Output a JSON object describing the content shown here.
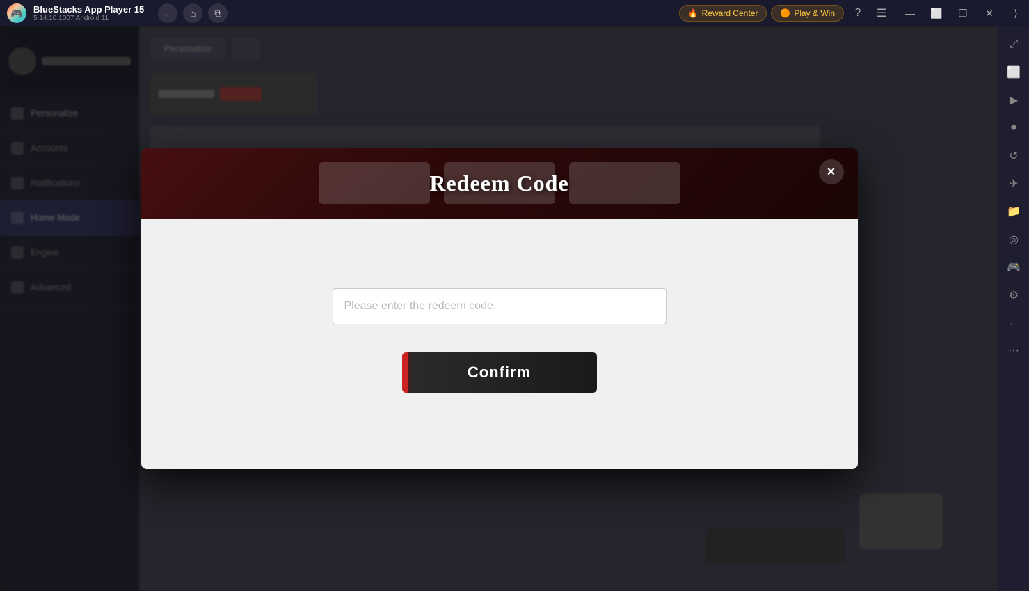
{
  "titleBar": {
    "appName": "BlueStacks App Player 15",
    "appVersion": "5.14.10.1007  Android 11",
    "rewardCenterLabel": "Reward Center",
    "playWinLabel": "Play & Win",
    "navBack": "←",
    "navHome": "⌂",
    "navMultiWindow": "⧉",
    "windowMinimize": "—",
    "windowMaximize": "⬜",
    "windowClose": "✕",
    "windowRestore": "❐"
  },
  "rightSidebar": {
    "icons": [
      {
        "name": "expand-icon",
        "symbol": "⤢"
      },
      {
        "name": "screenshot-icon",
        "symbol": "📷"
      },
      {
        "name": "camera-icon",
        "symbol": "🎥"
      },
      {
        "name": "record-icon",
        "symbol": "⏺"
      },
      {
        "name": "rotate-icon",
        "symbol": "↻"
      },
      {
        "name": "shake-icon",
        "symbol": "≋"
      },
      {
        "name": "volume-icon",
        "symbol": "📁"
      },
      {
        "name": "location-icon",
        "symbol": "⊕"
      },
      {
        "name": "gamepad-icon",
        "symbol": "🎮"
      },
      {
        "name": "settings-icon",
        "symbol": "⚙"
      },
      {
        "name": "back-arrow-icon",
        "symbol": "←"
      },
      {
        "name": "more-icon",
        "symbol": "···"
      }
    ]
  },
  "leftPanel": {
    "items": [
      {
        "label": "Personalize",
        "active": false
      },
      {
        "label": "Accounts",
        "active": false
      },
      {
        "label": "Notifications",
        "active": false
      },
      {
        "label": "Home Mode",
        "active": true
      },
      {
        "label": "Engine",
        "active": false
      },
      {
        "label": "Advanced",
        "active": false
      }
    ]
  },
  "modal": {
    "title": "Redeem Code",
    "closeLabel": "×",
    "inputPlaceholder": "Please enter the redeem code.",
    "confirmLabel": "Confirm",
    "instructionText": ""
  }
}
